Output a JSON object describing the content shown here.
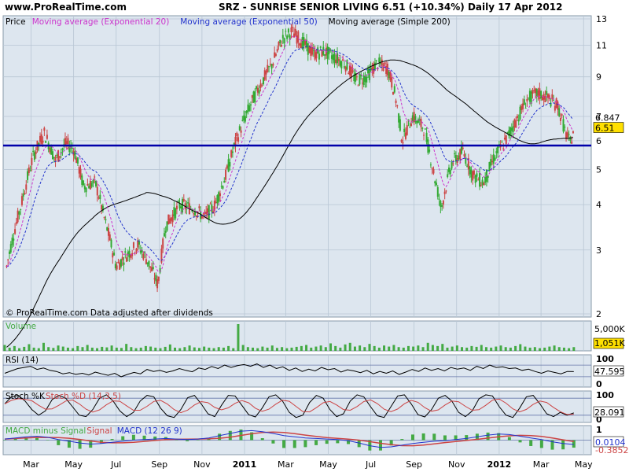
{
  "header": {
    "site": "www.ProRealTime.com",
    "title": "SRZ - SUNRISE SENIOR LIVING    6.51 (+10.34%)    Daily  17 Apr 2012"
  },
  "colors": {
    "panel_bg": "#dde6ef",
    "candle_up": "#33aa33",
    "candle_down": "#cc4444",
    "ema20": "#cc33cc",
    "ema50": "#2233cc",
    "sma200": "#000000",
    "hline": "#0000aa",
    "badge_fill": "#ffe000",
    "volume_bar": "#44aa44",
    "rsi_line": "#000000",
    "stoch_k": "#000000",
    "stoch_d": "#cc4444",
    "macd_hist": "#44aa44",
    "macd_signal": "#cc4444",
    "macd_line": "#2233cc"
  },
  "chart_data": [
    {
      "type": "candlestick",
      "title": "SRZ - SUNRISE SENIOR LIVING",
      "legend": [
        {
          "name": "Price",
          "color": "#000000"
        },
        {
          "name": "Moving average (Exponential 20)",
          "color": "#cc33cc"
        },
        {
          "name": "Moving average (Exponential 50)",
          "color": "#2233cc"
        },
        {
          "name": "Moving average (Simple 200)",
          "color": "#000000"
        }
      ],
      "note": "© ProRealTime.com  Data adjusted after dividends",
      "y_scale": "log",
      "ylim": [
        2,
        13
      ],
      "y_ticks": [
        2,
        3,
        4,
        5,
        6,
        7,
        9,
        11,
        13
      ],
      "x_ticks": [
        "Mar",
        "May",
        "Jul",
        "Sep",
        "Nov",
        "2011",
        "Mar",
        "May",
        "Jul",
        "Sep",
        "Nov",
        "2012",
        "Mar",
        "May"
      ],
      "x_tick_bold": [
        "2011",
        "2012"
      ],
      "x_tick_dates": [
        "2010-03-01",
        "2010-05-01",
        "2010-07-01",
        "2010-09-01",
        "2010-11-01",
        "2011-01-01",
        "2011-03-01",
        "2011-05-01",
        "2011-07-01",
        "2011-09-01",
        "2011-11-01",
        "2012-01-01",
        "2012-03-01",
        "2012-05-01"
      ],
      "horizontal_line": 5.82,
      "last_price_label": "6.51",
      "ma_label": "6.847",
      "close_points": [
        [
          "2010-01-25",
          2.7
        ],
        [
          "2010-02-15",
          4.0
        ],
        [
          "2010-03-05",
          5.5
        ],
        [
          "2010-03-20",
          6.3
        ],
        [
          "2010-04-05",
          5.3
        ],
        [
          "2010-04-20",
          5.9
        ],
        [
          "2010-05-01",
          5.7
        ],
        [
          "2010-05-15",
          4.5
        ],
        [
          "2010-06-01",
          4.6
        ],
        [
          "2010-06-15",
          3.6
        ],
        [
          "2010-07-01",
          2.7
        ],
        [
          "2010-07-15",
          2.9
        ],
        [
          "2010-08-01",
          3.1
        ],
        [
          "2010-08-15",
          2.8
        ],
        [
          "2010-08-30",
          2.4
        ],
        [
          "2010-09-10",
          3.5
        ],
        [
          "2010-10-01",
          4.0
        ],
        [
          "2010-10-20",
          3.9
        ],
        [
          "2010-11-05",
          3.7
        ],
        [
          "2010-11-20",
          4.0
        ],
        [
          "2010-12-05",
          4.8
        ],
        [
          "2010-12-20",
          6.0
        ],
        [
          "2011-01-05",
          7.2
        ],
        [
          "2011-01-20",
          8.3
        ],
        [
          "2011-02-10",
          9.8
        ],
        [
          "2011-02-25",
          11.5
        ],
        [
          "2011-03-10",
          12.0
        ],
        [
          "2011-03-25",
          11.2
        ],
        [
          "2011-04-10",
          10.4
        ],
        [
          "2011-04-25",
          10.6
        ],
        [
          "2011-05-10",
          10.2
        ],
        [
          "2011-05-25",
          9.8
        ],
        [
          "2011-06-10",
          8.8
        ],
        [
          "2011-06-25",
          9.0
        ],
        [
          "2011-07-10",
          9.8
        ],
        [
          "2011-07-25",
          9.5
        ],
        [
          "2011-08-05",
          8.0
        ],
        [
          "2011-08-15",
          6.0
        ],
        [
          "2011-08-30",
          7.0
        ],
        [
          "2011-09-15",
          6.5
        ],
        [
          "2011-09-30",
          4.8
        ],
        [
          "2011-10-10",
          3.9
        ],
        [
          "2011-10-25",
          5.2
        ],
        [
          "2011-11-10",
          5.6
        ],
        [
          "2011-11-25",
          4.8
        ],
        [
          "2011-12-10",
          4.6
        ],
        [
          "2011-12-25",
          5.4
        ],
        [
          "2012-01-10",
          6.0
        ],
        [
          "2012-01-25",
          6.8
        ],
        [
          "2012-02-10",
          7.8
        ],
        [
          "2012-02-25",
          8.1
        ],
        [
          "2012-03-10",
          7.9
        ],
        [
          "2012-03-25",
          7.5
        ],
        [
          "2012-04-05",
          6.3
        ],
        [
          "2012-04-12",
          5.9
        ],
        [
          "2012-04-17",
          6.51
        ]
      ]
    },
    {
      "type": "bar",
      "title": "Volume",
      "y_ticks": [
        "5,000K"
      ],
      "last_value_label": "1,051K",
      "values": [
        0.22,
        0.12,
        0.18,
        0.1,
        0.15,
        0.25,
        0.12,
        0.1,
        0.3,
        0.14,
        0.11,
        0.2,
        0.16,
        0.12,
        0.1,
        0.18,
        0.14,
        0.22,
        0.12,
        0.1,
        0.15,
        0.13,
        0.2,
        0.12,
        0.11,
        0.26,
        0.14,
        0.1,
        0.12,
        0.18,
        0.16,
        0.12,
        0.1,
        0.15,
        0.24,
        0.12,
        0.1,
        0.14,
        0.2,
        0.13,
        0.11,
        0.16,
        0.12,
        0.1,
        0.14,
        0.12,
        0.18,
        0.1,
        1.0,
        0.22,
        0.14,
        0.12,
        0.1,
        0.16,
        0.12,
        0.2,
        0.11,
        0.14,
        0.1,
        0.12,
        0.15,
        0.18,
        0.22,
        0.12,
        0.16,
        0.2,
        0.14,
        0.28,
        0.18,
        0.12,
        0.24,
        0.3,
        0.16,
        0.2,
        0.14,
        0.26,
        0.18,
        0.12,
        0.2,
        0.16,
        0.22,
        0.14,
        0.12,
        0.18,
        0.16,
        0.2,
        0.14,
        0.3,
        0.22,
        0.18,
        0.26,
        0.12,
        0.16,
        0.2,
        0.14,
        0.12,
        0.18,
        0.15,
        0.22,
        0.14,
        0.12,
        0.16,
        0.2,
        0.14,
        0.12,
        0.18,
        0.25,
        0.16,
        0.12,
        0.14,
        0.1,
        0.12,
        0.16,
        0.2,
        0.14,
        0.12,
        0.1,
        0.14
      ]
    },
    {
      "type": "line",
      "title": "RSI (14)",
      "ylim": [
        0,
        100
      ],
      "y_ticks": [
        0,
        100
      ],
      "reference_lines": [
        30,
        70
      ],
      "last_value_label": "47.595",
      "values": [
        42,
        50,
        58,
        62,
        66,
        55,
        60,
        52,
        48,
        40,
        44,
        38,
        42,
        36,
        46,
        40,
        35,
        42,
        30,
        38,
        45,
        40,
        55,
        48,
        52,
        45,
        50,
        58,
        52,
        47,
        60,
        55,
        65,
        58,
        70,
        62,
        68,
        72,
        66,
        74,
        62,
        70,
        58,
        64,
        52,
        60,
        48,
        56,
        50,
        62,
        54,
        58,
        46,
        54,
        50,
        44,
        52,
        40,
        48,
        42,
        50,
        38,
        46,
        55,
        48,
        60,
        52,
        58,
        50,
        62,
        56,
        60,
        52,
        66,
        58,
        70,
        62,
        64,
        58,
        60,
        52,
        56,
        48,
        42,
        50,
        45,
        40,
        48,
        47.595
      ]
    },
    {
      "type": "line",
      "title": "Stoch %K",
      "series": [
        {
          "name": "Stoch %K",
          "color": "#000000"
        },
        {
          "name": "Stoch %D (14,3,5)",
          "color": "#cc4444"
        }
      ],
      "ylim": [
        0,
        100
      ],
      "y_ticks": [
        0,
        100
      ],
      "reference_lines": [
        20,
        80
      ],
      "last_value_label": "28.091",
      "values": [
        60,
        85,
        90,
        70,
        40,
        20,
        35,
        75,
        90,
        80,
        50,
        20,
        15,
        40,
        80,
        92,
        70,
        35,
        15,
        30,
        70,
        90,
        85,
        45,
        18,
        12,
        40,
        82,
        90,
        60,
        25,
        15,
        55,
        90,
        88,
        55,
        22,
        14,
        45,
        85,
        92,
        70,
        30,
        12,
        20,
        65,
        90,
        80,
        40,
        15,
        25,
        70,
        92,
        85,
        50,
        18,
        12,
        50,
        88,
        92,
        60,
        22,
        14,
        40,
        80,
        90,
        70,
        30,
        15,
        35,
        78,
        92,
        88,
        50,
        20,
        12,
        45,
        85,
        90,
        60,
        25,
        15,
        30,
        20,
        28.091
      ]
    },
    {
      "type": "line",
      "title": "MACD (12 26 9)",
      "series": [
        {
          "name": "MACD minus Signal",
          "color": "#44aa44"
        },
        {
          "name": "Signal",
          "color": "#cc4444"
        },
        {
          "name": "MACD (12 26 9)",
          "color": "#2233cc"
        }
      ],
      "ylim": [
        -1,
        1
      ],
      "y_ticks": [
        1
      ],
      "last_value_label": "0.0104",
      "last_value_label_2": "-0.3852",
      "values": [
        0.1,
        0.2,
        0.3,
        0.35,
        0.25,
        0.05,
        -0.1,
        -0.25,
        -0.35,
        -0.3,
        -0.2,
        -0.1,
        0.0,
        0.05,
        0.1,
        0.15,
        0.1,
        0.05,
        0.1,
        0.2,
        0.4,
        0.6,
        0.8,
        0.85,
        0.75,
        0.6,
        0.4,
        0.3,
        0.2,
        0.15,
        0.1,
        0.05,
        -0.05,
        -0.25,
        -0.5,
        -0.65,
        -0.6,
        -0.45,
        -0.3,
        -0.2,
        -0.1,
        -0.05,
        0.05,
        0.15,
        0.3,
        0.45,
        0.55,
        0.5,
        0.35,
        0.2,
        0.05,
        -0.15,
        -0.3,
        -0.3852
      ]
    }
  ]
}
